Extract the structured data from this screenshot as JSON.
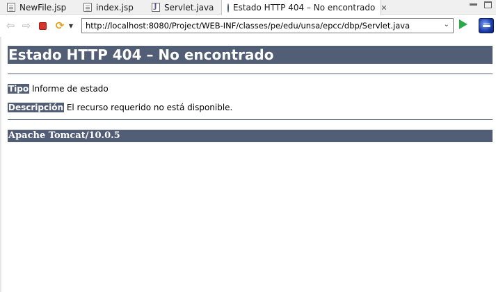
{
  "tabs": [
    {
      "label": "NewFile.jsp",
      "icon": "jsp-file-icon",
      "active": false
    },
    {
      "label": "index.jsp",
      "icon": "jsp-file-icon",
      "active": false
    },
    {
      "label": "Servlet.java",
      "icon": "java-file-icon",
      "active": false
    },
    {
      "label": "Estado HTTP 404 – No encontrado",
      "icon": "globe-icon",
      "active": true
    }
  ],
  "toolbar": {
    "url": "http://localhost:8080/Project/WEB-INF/classes/pe/edu/unsa/epcc/dbp/Servlet.java",
    "icons": [
      "back-icon",
      "forward-icon",
      "stop-icon",
      "refresh-icon",
      "dropdown-arrow-icon",
      "go-icon",
      "eclipse-icon"
    ]
  },
  "page": {
    "title": "Estado HTTP 404 – No encontrado",
    "type_label": "Tipo",
    "type_value": "Informe de estado",
    "description_label": "Descripción",
    "description_value": "El recurso requerido no está disponible.",
    "server": "Apache Tomcat/10.0.5"
  },
  "colors": {
    "header_bg": "#525d76",
    "header_text": "#ffffff",
    "go_green": "#2aa84a",
    "stop_red": "#d9342b"
  }
}
